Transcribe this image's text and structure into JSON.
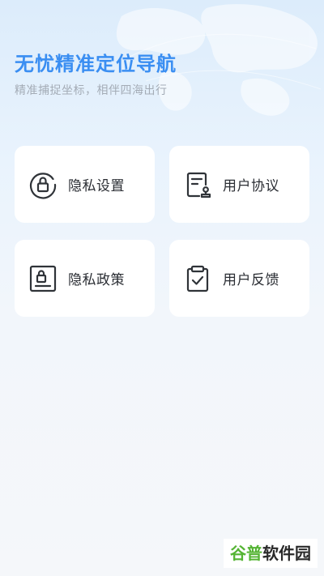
{
  "header": {
    "title": "无忧精准定位导航",
    "subtitle": "精准捕捉坐标，相伴四海出行"
  },
  "menu": {
    "items": [
      {
        "id": "privacy-settings",
        "label": "隐私设置",
        "icon": "lock-circle-icon"
      },
      {
        "id": "user-agreement",
        "label": "用户协议",
        "icon": "document-stamp-icon"
      },
      {
        "id": "privacy-policy",
        "label": "隐私政策",
        "icon": "lock-document-icon"
      },
      {
        "id": "user-feedback",
        "label": "用户反馈",
        "icon": "clipboard-check-icon"
      }
    ]
  },
  "watermark": {
    "part_a": "谷普",
    "part_b": "软件园"
  },
  "colors": {
    "accent": "#3a8ef2",
    "subtitle": "#a4acb6",
    "card_bg": "#ffffff",
    "text": "#2a2d33",
    "icon_stroke": "#2f3338"
  }
}
